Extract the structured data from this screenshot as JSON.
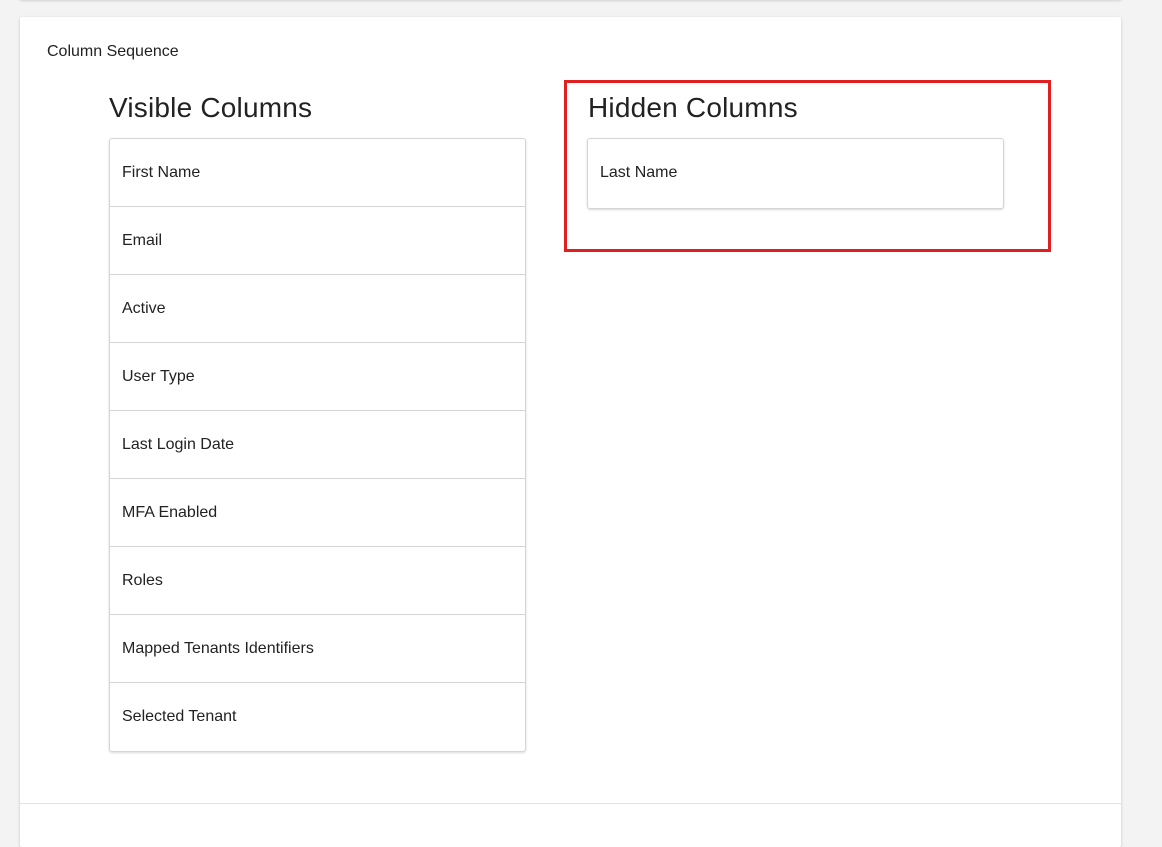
{
  "section": {
    "title": "Column Sequence"
  },
  "visible_columns": {
    "heading": "Visible Columns",
    "items": [
      {
        "label": "First Name"
      },
      {
        "label": "Email"
      },
      {
        "label": "Active"
      },
      {
        "label": "User Type"
      },
      {
        "label": "Last Login Date"
      },
      {
        "label": "MFA Enabled"
      },
      {
        "label": "Roles"
      },
      {
        "label": "Mapped Tenants Identifiers"
      },
      {
        "label": "Selected Tenant"
      }
    ]
  },
  "hidden_columns": {
    "heading": "Hidden Columns",
    "items": [
      {
        "label": "Last Name"
      }
    ]
  },
  "colors": {
    "highlight": "#e02020",
    "border": "#d5d5d5",
    "background": "#f3f3f3",
    "card": "#ffffff"
  }
}
